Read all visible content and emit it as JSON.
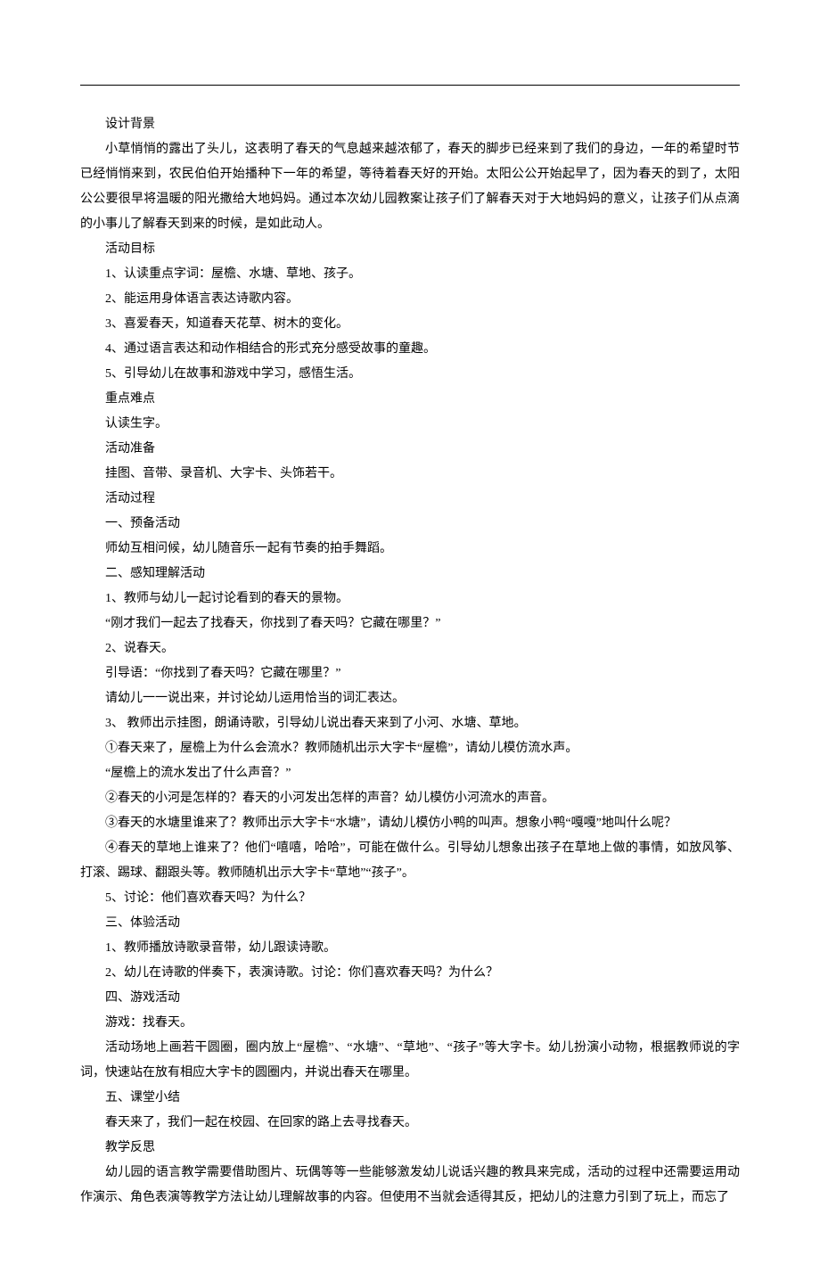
{
  "sections": {
    "background": {
      "heading": "设计背景",
      "body": "小草悄悄的露出了头儿，这表明了春天的气息越来越浓郁了，春天的脚步已经来到了我们的身边，一年的希望时节已经悄悄来到，农民伯伯开始播种下一年的希望，等待着春天好的开始。太阳公公开始起早了，因为春天的到了，太阳公公要很早将温暖的阳光撒给大地妈妈。通过本次幼儿园教案让孩子们了解春天对于大地妈妈的意义，让孩子们从点滴的小事儿了解春天到来的时候，是如此动人。"
    },
    "objectives": {
      "heading": "活动目标",
      "items": [
        "1、认读重点字词：屋檐、水塘、草地、孩子。",
        "2、能运用身体语言表达诗歌内容。",
        "3、喜爱春天，知道春天花草、树木的变化。",
        "4、通过语言表达和动作相结合的形式充分感受故事的童趣。",
        "5、引导幼儿在故事和游戏中学习，感悟生活。"
      ]
    },
    "keypoints": {
      "heading": "重点难点",
      "body": "认读生字。"
    },
    "preparation": {
      "heading": "活动准备",
      "body": "挂图、音带、录音机、大字卡、头饰若干。"
    },
    "process": {
      "heading": "活动过程",
      "step1": {
        "title": "一、预备活动",
        "body": "师幼互相问候，幼儿随音乐一起有节奏的拍手舞蹈。"
      },
      "step2": {
        "title": "二、感知理解活动",
        "item1": "1、教师与幼儿一起讨论看到的春天的景物。",
        "quote1": "“刚才我们一起去了找春天，你找到了春天吗？它藏在哪里？”",
        "item2": "2、说春天。",
        "guide": "引导语：“你找到了春天吗？它藏在哪里？”",
        "guide_body": "请幼儿一一说出来，并讨论幼儿运用恰当的词汇表达。",
        "item3": "3、 教师出示挂图，朗诵诗歌，引导幼儿说出春天来到了小河、水塘、草地。",
        "sub1": "①春天来了，屋檐上为什么会流水？教师随机出示大字卡“屋檐”，请幼儿模仿流水声。",
        "quote2": "“屋檐上的流水发出了什么声音？”",
        "sub2": "②春天的小河是怎样的？春天的小河发出怎样的声音？幼儿模仿小河流水的声音。",
        "sub3": "③春天的水塘里谁来了？教师出示大字卡“水塘”，请幼儿模仿小鸭的叫声。想象小鸭“嘎嘎”地叫什么呢？",
        "sub4": "④春天的草地上谁来了？他们“嘻嘻，哈哈”，可能在做什么。引导幼儿想象出孩子在草地上做的事情，如放风筝、打滚、踢球、翻跟头等。教师随机出示大字卡“草地”“孩子”。",
        "item5": "5、讨论：他们喜欢春天吗？为什么？"
      },
      "step3": {
        "title": "三、体验活动",
        "item1": "1、教师播放诗歌录音带，幼儿跟读诗歌。",
        "item2": "2、幼儿在诗歌的伴奏下，表演诗歌。讨论：你们喜欢春天吗？为什么？"
      },
      "step4": {
        "title": "四、游戏活动",
        "game_title": "游戏：找春天。",
        "game_body": "活动场地上画若干圆圈，圈内放上“屋檐”、“水塘”、“草地”、“孩子”等大字卡。幼儿扮演小动物，根据教师说的字词，快速站在放有相应大字卡的圆圈内，并说出春天在哪里。"
      },
      "step5": {
        "title": "五、课堂小结",
        "body": "春天来了，我们一起在校园、在回家的路上去寻找春天。"
      }
    },
    "reflection": {
      "heading": "教学反思",
      "body": "幼儿园的语言教学需要借助图片、玩偶等等一些能够激发幼儿说话兴趣的教具来完成，活动的过程中还需要运用动作演示、角色表演等教学方法让幼儿理解故事的内容。但使用不当就会适得其反，把幼儿的注意力引到了玩上，而忘了"
    }
  }
}
